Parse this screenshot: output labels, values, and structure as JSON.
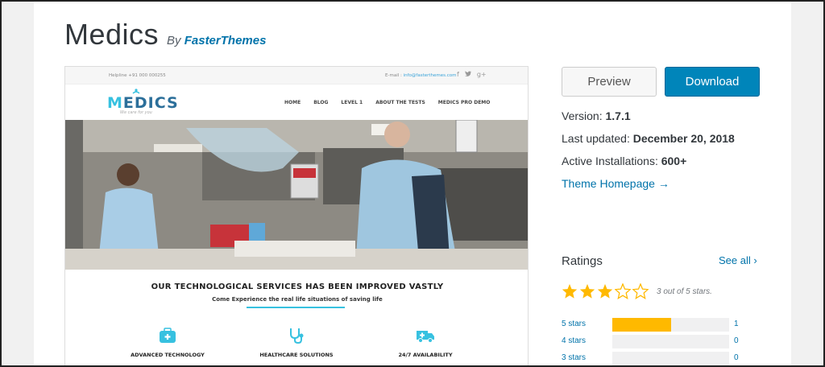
{
  "theme": {
    "name": "Medics",
    "by_prefix": "By",
    "author": "FasterThemes"
  },
  "preview": {
    "topbar": {
      "helpline": "Helpline +91 000 000255",
      "email_prefix": "E-mail :",
      "email": "info@fasterthemes.com",
      "social": [
        "f",
        "♣",
        "g+"
      ]
    },
    "logo": {
      "initial": "M",
      "rest": "EDICS",
      "tagline": "We care for you"
    },
    "menu": [
      "HOME",
      "BLOG",
      "LEVEL 1",
      "ABOUT THE TESTS",
      "MEDICS PRO DEMO"
    ],
    "section_title": "OUR TECHNOLOGICAL SERVICES HAS BEEN IMPROVED VASTLY",
    "section_sub": "Come Experience the real life situations of saving life",
    "features": [
      {
        "label": "ADVANCED TECHNOLOGY",
        "icon": "medkit-icon"
      },
      {
        "label": "HEALTHCARE SOLUTIONS",
        "icon": "stethoscope-icon"
      },
      {
        "label": "24/7 AVAILABILITY",
        "icon": "ambulance-icon"
      }
    ],
    "accent": "#37c1e0"
  },
  "actions": {
    "preview_label": "Preview",
    "download_label": "Download"
  },
  "meta": {
    "version_label": "Version:",
    "version": "1.7.1",
    "updated_label": "Last updated:",
    "updated": "December 20, 2018",
    "installs_label": "Active Installations:",
    "installs": "600+",
    "homepage_link": "Theme Homepage →"
  },
  "ratings": {
    "heading": "Ratings",
    "see_all": "See all",
    "stars_filled": 3,
    "stars_total": 5,
    "stars_text": "3 out of 5 stars.",
    "rows": [
      {
        "label": "5 stars",
        "count": "1",
        "fraction": 0.5
      },
      {
        "label": "4 stars",
        "count": "0",
        "fraction": 0
      },
      {
        "label": "3 stars",
        "count": "0",
        "fraction": 0
      }
    ]
  },
  "colors": {
    "link": "#0073aa",
    "download_bg": "#0085ba",
    "star": "#ffb900"
  }
}
